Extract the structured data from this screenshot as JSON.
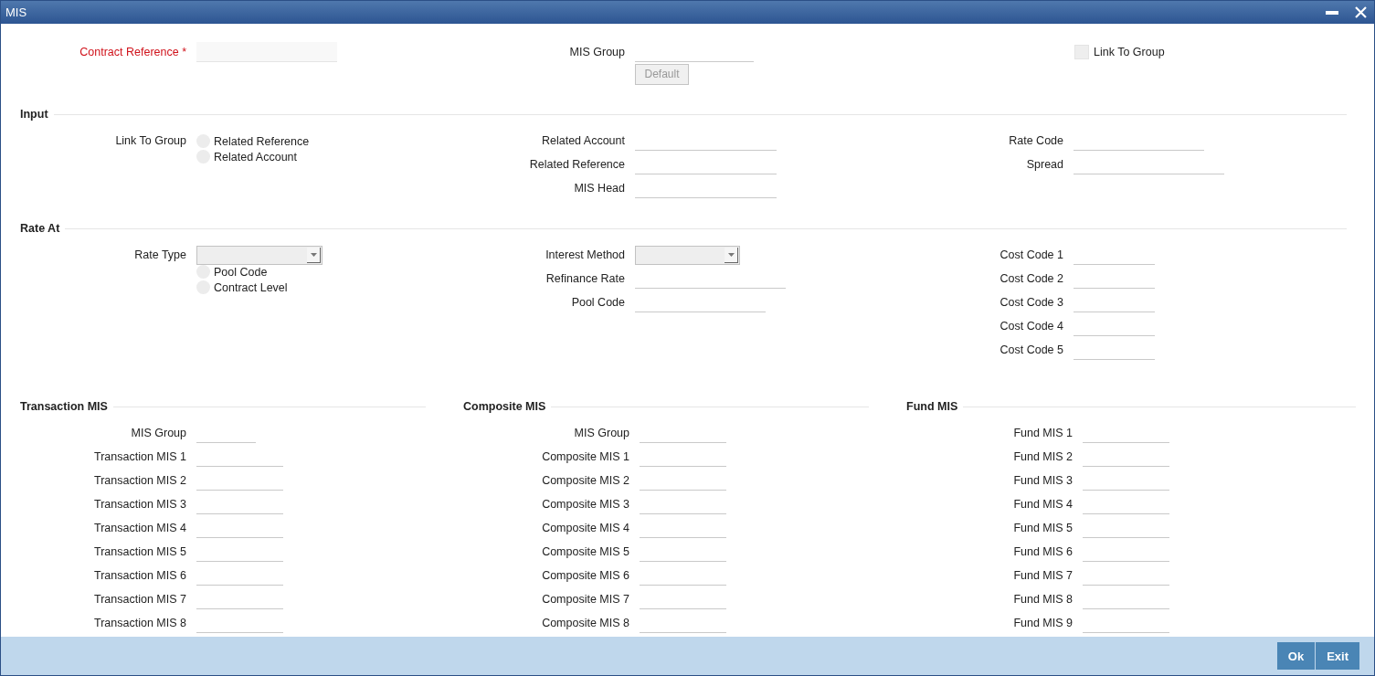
{
  "window": {
    "title": "MIS"
  },
  "header": {
    "contract_reference": {
      "label": "Contract Reference",
      "required_mark": "*"
    },
    "mis_group": {
      "label": "MIS Group"
    },
    "default_button": {
      "label": "Default",
      "disabled": true
    },
    "link_to_group": {
      "label": "Link To Group",
      "checked": false
    }
  },
  "input": {
    "title": "Input",
    "link_to_group": {
      "label": "Link To Group",
      "options": [
        {
          "label": "Related Reference",
          "selected": false
        },
        {
          "label": "Related Account",
          "selected": false
        }
      ]
    },
    "middle_fields": [
      "Related Account",
      "Related Reference",
      "MIS Head"
    ],
    "right_fields": [
      "Rate Code",
      "Spread"
    ]
  },
  "rate_at": {
    "title": "Rate At",
    "rate_type": {
      "label": "Rate Type"
    },
    "options": [
      {
        "label": "Pool Code",
        "selected": false
      },
      {
        "label": "Contract Level",
        "selected": false
      }
    ],
    "interest_method": {
      "label": "Interest Method"
    },
    "middle_fields": [
      "Refinance Rate",
      "Pool Code"
    ],
    "cost_codes": [
      "Cost Code 1",
      "Cost Code 2",
      "Cost Code 3",
      "Cost Code 4",
      "Cost Code 5"
    ]
  },
  "mis_sections": [
    {
      "title": "Transaction MIS",
      "fields": [
        "MIS Group",
        "Transaction MIS 1",
        "Transaction MIS 2",
        "Transaction MIS 3",
        "Transaction MIS 4",
        "Transaction MIS 5",
        "Transaction MIS 6",
        "Transaction MIS 7",
        "Transaction MIS 8"
      ]
    },
    {
      "title": "Composite MIS",
      "fields": [
        "MIS Group",
        "Composite MIS 1",
        "Composite MIS 2",
        "Composite MIS 3",
        "Composite MIS 4",
        "Composite MIS 5",
        "Composite MIS 6",
        "Composite MIS 7",
        "Composite MIS 8"
      ]
    },
    {
      "title": "Fund MIS",
      "fields": [
        "Fund MIS 1",
        "Fund MIS 2",
        "Fund MIS 3",
        "Fund MIS 4",
        "Fund MIS 5",
        "Fund MIS 6",
        "Fund MIS 7",
        "Fund MIS 8",
        "Fund MIS 9"
      ]
    }
  ],
  "buttons": [
    "Ok",
    "Exit"
  ]
}
